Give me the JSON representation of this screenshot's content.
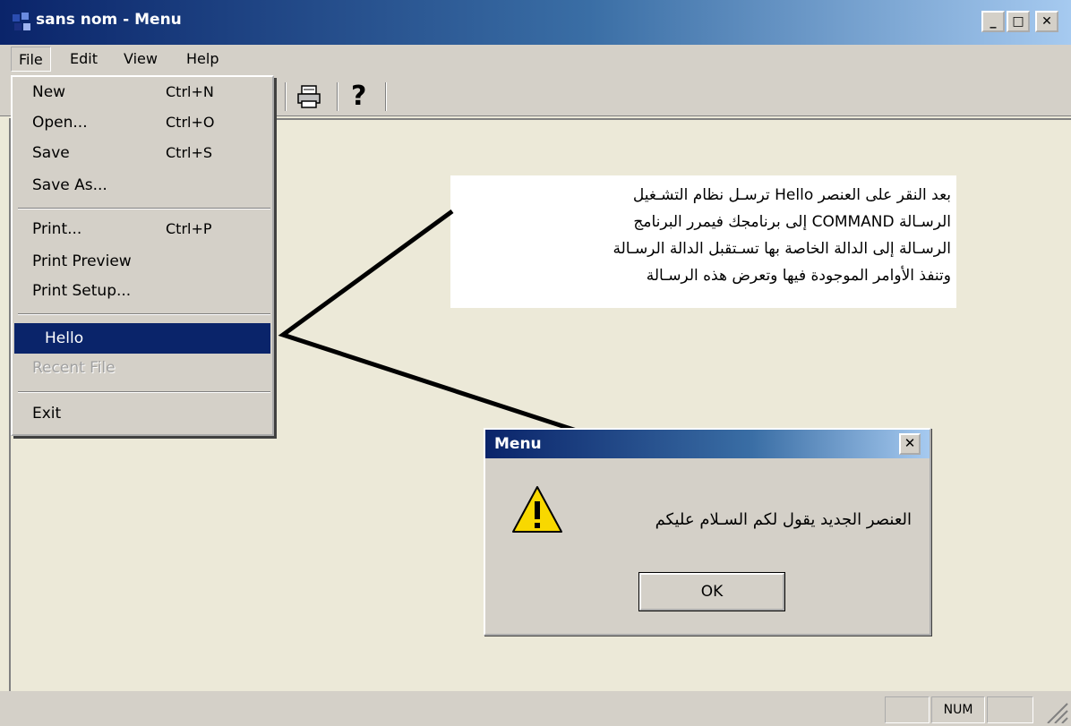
{
  "window": {
    "title": "sans nom - Menu",
    "min": "_",
    "max": "□",
    "close": "✕"
  },
  "menubar": {
    "file": "File",
    "edit": "Edit",
    "view": "View",
    "help": "Help"
  },
  "file_menu": {
    "items": [
      {
        "label": "New",
        "shortcut": "Ctrl+N"
      },
      {
        "label": "Open...",
        "shortcut": "Ctrl+O"
      },
      {
        "label": "Save",
        "shortcut": "Ctrl+S"
      },
      {
        "label": "Save As...",
        "shortcut": ""
      },
      {
        "label": "Print...",
        "shortcut": "Ctrl+P"
      },
      {
        "label": "Print Preview",
        "shortcut": ""
      },
      {
        "label": "Print Setup...",
        "shortcut": ""
      },
      {
        "label": "Hello",
        "shortcut": ""
      },
      {
        "label": "Recent File",
        "shortcut": ""
      },
      {
        "label": "Exit",
        "shortcut": ""
      }
    ]
  },
  "toolbar": {
    "help_glyph": "?"
  },
  "annotation": {
    "lines": [
      "بعد النقر على العنصر Hello ترسـل نظام التشـغيل",
      "الرسـالة COMMAND إلى برنامجك فيمرر البرنامج",
      "الرسـالة إلى الدالة الخاصة بها تسـتقبل الدالة الرسـالة",
      "وتنفذ الأوامر الموجودة فيها وتعرض هذه الرسـالة"
    ]
  },
  "message_box": {
    "title": "Menu",
    "close": "✕",
    "text": "العنصر الجديد يقول لكم السـلام عليكم",
    "ok": "OK"
  },
  "statusbar": {
    "num": "NUM"
  }
}
